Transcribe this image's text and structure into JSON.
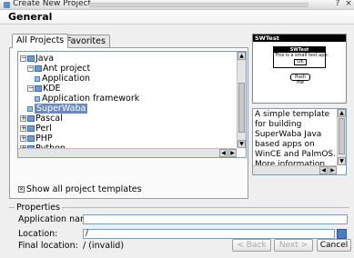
{
  "window": {
    "title": "Create New Project",
    "controls": [
      "?",
      "×"
    ]
  },
  "heading": "General",
  "tabs": [
    {
      "label": "All Projects",
      "active": true
    },
    {
      "label": "Favorites",
      "active": false
    }
  ],
  "tree": [
    {
      "label": "Java",
      "depth": 0,
      "expander": "−",
      "icon": "folder"
    },
    {
      "label": "Ant project",
      "depth": 1,
      "expander": "−",
      "icon": "folder"
    },
    {
      "label": "Application",
      "depth": 2,
      "expander": "",
      "icon": "leaf"
    },
    {
      "label": "KDE",
      "depth": 1,
      "expander": "−",
      "icon": "folder"
    },
    {
      "label": "Application framework",
      "depth": 2,
      "expander": "",
      "icon": "leaf"
    },
    {
      "label": "SuperWaba",
      "depth": 1,
      "expander": "",
      "icon": "leaf",
      "selected": true
    },
    {
      "label": "Pascal",
      "depth": 0,
      "expander": "+",
      "icon": "folder"
    },
    {
      "label": "Perl",
      "depth": 0,
      "expander": "+",
      "icon": "folder"
    },
    {
      "label": "PHP",
      "depth": 0,
      "expander": "+",
      "icon": "folder"
    },
    {
      "label": "Python",
      "depth": 0,
      "expander": "+",
      "icon": "folder"
    }
  ],
  "preview": {
    "title": "SWTest",
    "dialog_title": "SWTest",
    "dialog_message": "This is a small test app.",
    "ok_label": "OK",
    "push_label": "Push me"
  },
  "description": "A simple template for building SuperWaba Java based apps on WinCE and PalmOS. More information can be found at http://...",
  "show_all": {
    "label": "Show all project templates",
    "checked": true
  },
  "properties": {
    "legend": "Properties",
    "app_name_label": "Application name:",
    "app_name_value": "",
    "location_label": "Location:",
    "location_value": "/",
    "final_location_label": "Final location:",
    "final_location_value": "/ (invalid)"
  },
  "buttons": {
    "back": "< Back",
    "next": "Next >",
    "cancel": "Cancel"
  },
  "colors": {
    "selection": "#6c8cb5",
    "input_border": "#7f9db9",
    "accent": "#4a7dc2"
  }
}
